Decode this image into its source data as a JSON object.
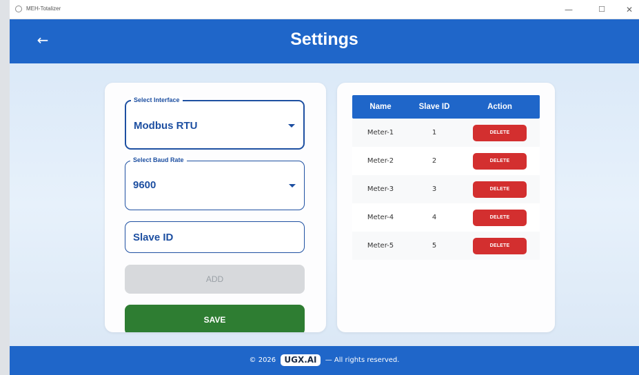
{
  "window": {
    "title": "MEH-Totalizer",
    "minimize_glyph": "—",
    "maximize_glyph": "☐",
    "close_glyph": "✕"
  },
  "header": {
    "back_glyph": "←",
    "title": "Settings"
  },
  "form": {
    "interface": {
      "legend": "Select Interface",
      "value": "Modbus RTU"
    },
    "baud": {
      "legend": "Select Baud Rate",
      "value": "9600"
    },
    "slave_id": {
      "placeholder": "Slave ID"
    },
    "add_label": "ADD",
    "save_label": "SAVE"
  },
  "table": {
    "headers": {
      "name": "Name",
      "slave_id": "Slave ID",
      "action": "Action"
    },
    "delete_label": "DELETE",
    "rows": [
      {
        "name": "Meter-1",
        "slave_id": "1"
      },
      {
        "name": "Meter-2",
        "slave_id": "2"
      },
      {
        "name": "Meter-3",
        "slave_id": "3"
      },
      {
        "name": "Meter-4",
        "slave_id": "4"
      },
      {
        "name": "Meter-5",
        "slave_id": "5"
      }
    ]
  },
  "footer": {
    "copyright": "© 2026",
    "logo": "UGX.AI",
    "rights": "— All rights reserved."
  },
  "colors": {
    "primary": "#1f66c9",
    "save": "#2e7d32",
    "delete": "#d32f2f",
    "field_text": "#1d4fa1"
  }
}
